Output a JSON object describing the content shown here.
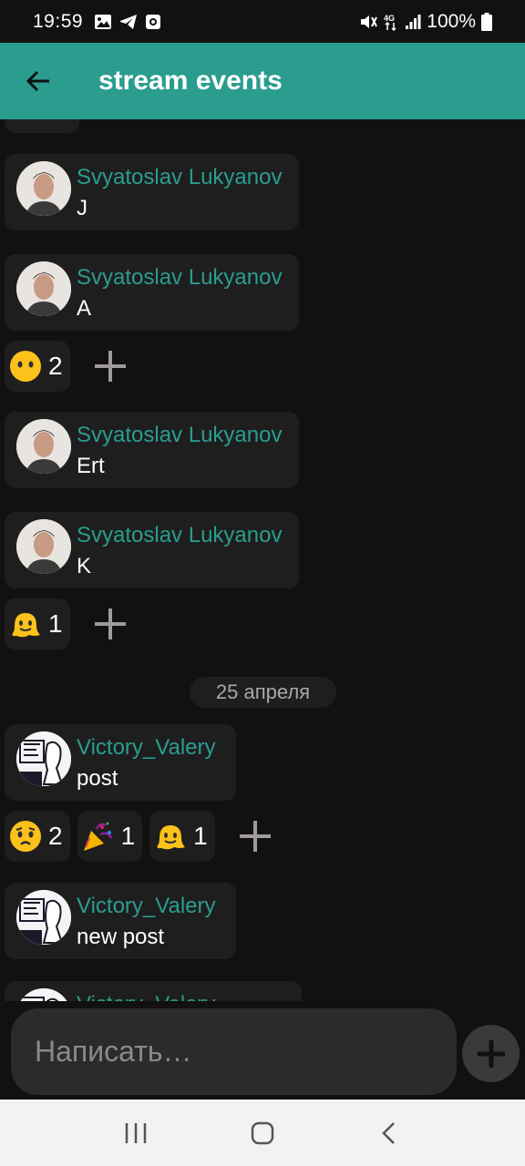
{
  "status_bar": {
    "time": "19:59",
    "battery": "100%",
    "left_icons": [
      "image-icon",
      "telegram-icon",
      "record-icon"
    ],
    "right_icons": [
      "mute-icon",
      "4g-icon",
      "signal-icon",
      "battery-icon"
    ]
  },
  "app_bar": {
    "title": "stream events",
    "back_icon": "arrow-left-icon",
    "color": "#2a9d8f"
  },
  "messages": [
    {
      "author": "Svyatoslav Lukyanov",
      "text": "J"
    },
    {
      "author": "Svyatoslav Lukyanov",
      "text": "A"
    },
    {
      "author": "Svyatoslav Lukyanov",
      "text": "Ert"
    },
    {
      "author": "Svyatoslav Lukyanov",
      "text": "K"
    },
    {
      "author": "Victory_Valery",
      "text": "post"
    },
    {
      "author": "Victory_Valery",
      "text": "new post"
    },
    {
      "author": "Victory_Valery",
      "text": ""
    }
  ],
  "reactions": {
    "after_A": [
      {
        "emoji": "neutral-face",
        "count": "2"
      }
    ],
    "after_K": [
      {
        "emoji": "melting-face",
        "count": "1"
      }
    ],
    "after_post": [
      {
        "emoji": "worried-face",
        "count": "2"
      },
      {
        "emoji": "party-popper",
        "count": "1"
      },
      {
        "emoji": "melting-face",
        "count": "1"
      }
    ]
  },
  "date_separator": "25 апреля",
  "composer": {
    "placeholder": "Написать…"
  },
  "nav_bar": {
    "icons": [
      "recents-icon",
      "home-icon",
      "back-icon"
    ]
  }
}
